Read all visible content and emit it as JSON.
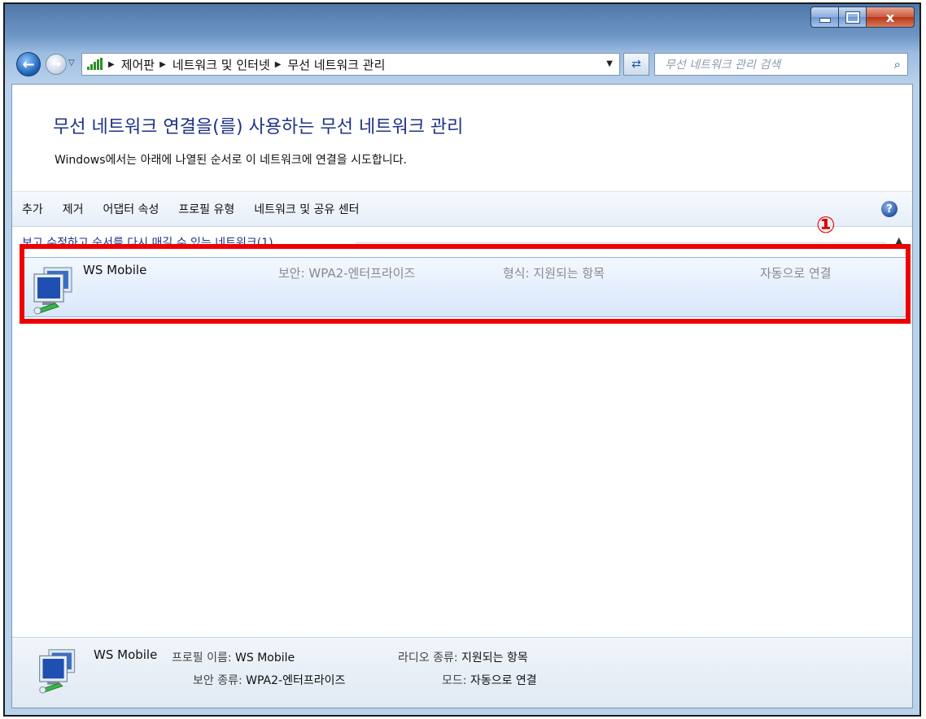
{
  "address": {
    "breadcrumbs": [
      "제어판",
      "네트워크 및 인터넷",
      "무선 네트워크 관리"
    ],
    "search_placeholder": "무선 네트워크 관리 검색"
  },
  "window_controls": {
    "close": "x"
  },
  "header": {
    "title": "무선 네트워크 연결을(를) 사용하는 무선 네트워크 관리",
    "subtitle": "Windows에서는 아래에 나열된 순서로 이 네트워크에 연결을 시도합니다."
  },
  "toolbar": {
    "items": [
      "추가",
      "제거",
      "어댑터 속성",
      "프로필 유형",
      "네트워크 및 공유 센터"
    ],
    "help": "?"
  },
  "group": {
    "label": "보고 수정하고 순서를 다시 매길 수 있는 네트워크(1)"
  },
  "network": {
    "name": "WS Mobile",
    "security": "보안: WPA2-엔터프라이즈",
    "type": "형식: 지원되는 항목",
    "mode": "자동으로 연결"
  },
  "annotation": {
    "marker": "①",
    "color": "#ee0000"
  },
  "details": {
    "name": "WS Mobile",
    "profile_label": "프로필 이름:",
    "profile_value": "WS Mobile",
    "security_label": "보안 종류:",
    "security_value": "WPA2-엔터프라이즈",
    "radio_label": "라디오 종류:",
    "radio_value": "지원되는 항목",
    "mode_label": "모드:",
    "mode_value": "자동으로 연결"
  },
  "icons": {
    "back": "arrow-left-icon",
    "forward": "arrow-right-icon",
    "refresh": "refresh-icon",
    "search": "search-icon",
    "help": "help-icon",
    "network": "wireless-network-icon"
  }
}
